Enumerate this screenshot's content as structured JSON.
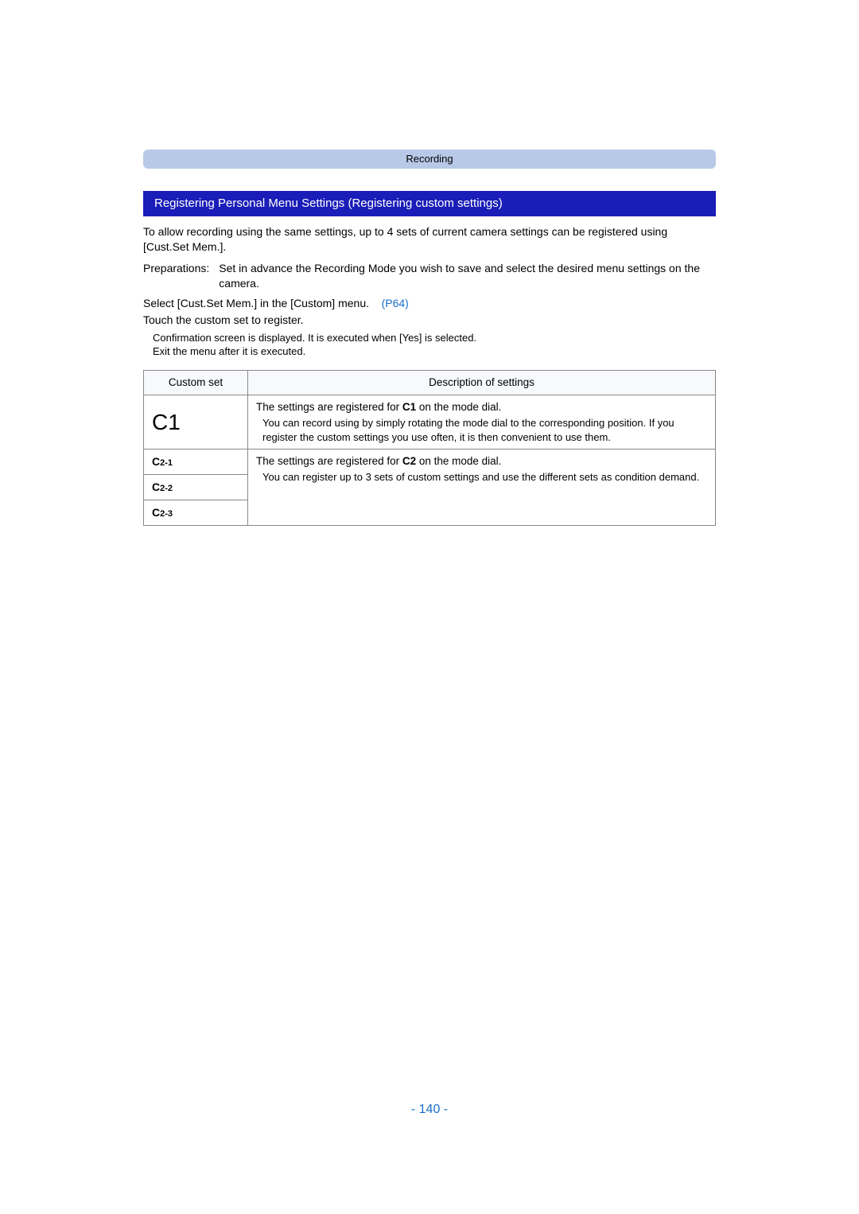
{
  "header": {
    "category": "Recording"
  },
  "section": {
    "title": "Registering Personal Menu Settings (Registering custom settings)"
  },
  "intro": "To allow recording using the same settings, up to 4 sets of current camera settings can be registered using [Cust.Set Mem.].",
  "preparations": {
    "label": "Preparations:",
    "text": "Set in advance the Recording Mode you wish to save and select the desired menu settings on the camera."
  },
  "steps": {
    "line1_pre": "Select [Cust.Set Mem.] in the [Custom] menu.",
    "line1_link": "(P64)",
    "line2": "Touch the custom set to register.",
    "note1": "Confirmation screen is displayed. It is executed when [Yes] is selected.",
    "note2": "Exit the menu after it is executed."
  },
  "table": {
    "head": {
      "col1": "Custom set",
      "col2": "Description of settings"
    },
    "row_c1": {
      "label": "C1",
      "main_pre": "The settings are registered for ",
      "main_icon": "C1",
      "main_post": " on the mode dial.",
      "sub": "You can record using by simply rotating the mode dial to the corresponding position. If you register the custom settings you use often, it is then convenient to use them."
    },
    "row_c2": {
      "labels": {
        "a": "C",
        "a_sub": "2-1",
        "b": "C",
        "b_sub": "2-2",
        "c": "C",
        "c_sub": "2-3"
      },
      "main_pre": "The settings are registered for ",
      "main_icon": "C2",
      "main_post": " on the mode dial.",
      "sub": "You can register up to 3 sets of custom settings and use the different sets as condition demand."
    }
  },
  "page_number": "- 140 -"
}
